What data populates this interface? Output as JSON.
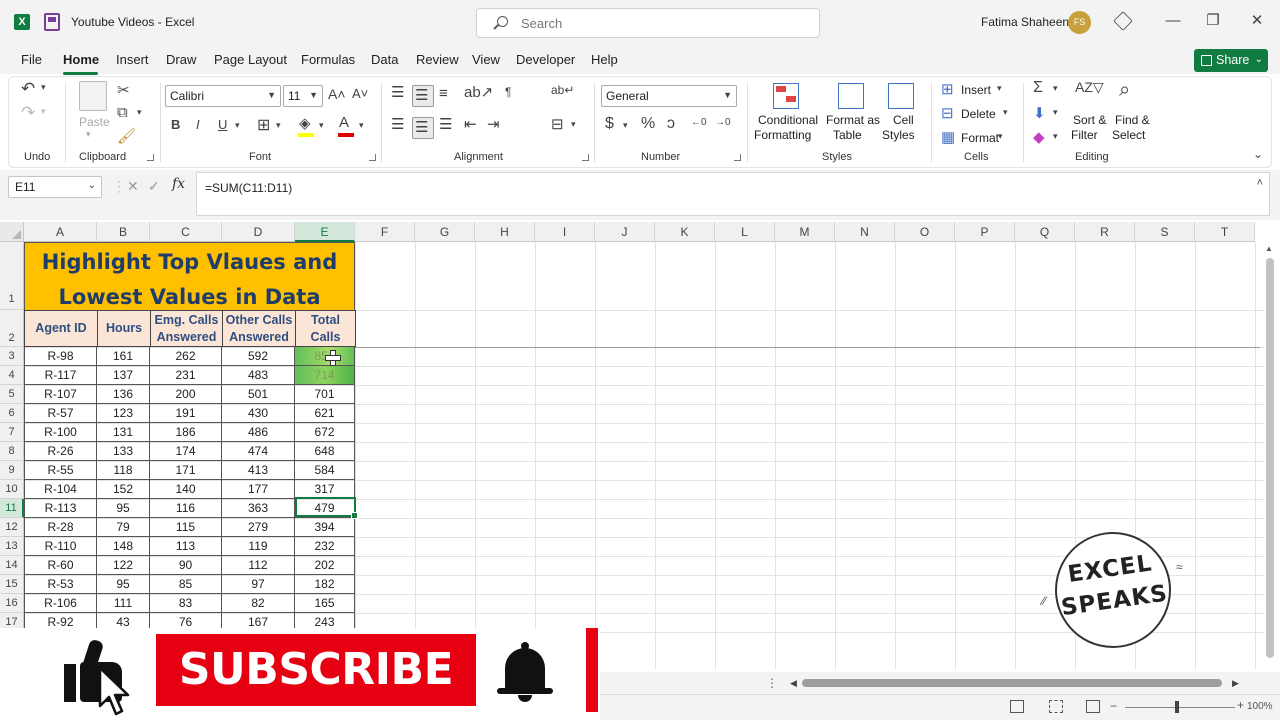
{
  "window": {
    "doc_title": "Youtube Videos  -  Excel",
    "search_placeholder": "Search",
    "user_name": "Fatima Shaheen",
    "user_initials": "FS"
  },
  "menu": {
    "items": [
      "File",
      "Home",
      "Insert",
      "Draw",
      "Page Layout",
      "Formulas",
      "Data",
      "Review",
      "View",
      "Developer",
      "Help"
    ],
    "active": "Home",
    "share_label": "Share"
  },
  "ribbon": {
    "groups": {
      "undo": "Undo",
      "clipboard": "Clipboard",
      "font": "Font",
      "alignment": "Alignment",
      "number": "Number",
      "styles": "Styles",
      "cells": "Cells",
      "editing": "Editing"
    },
    "paste_label": "Paste",
    "font_name": "Calibri",
    "font_size": "11",
    "number_format": "General",
    "conditional_formatting": [
      "Conditional",
      "Formatting"
    ],
    "format_as_table": [
      "Format as",
      "Table"
    ],
    "cell_styles": [
      "Cell",
      "Styles"
    ],
    "insert_label": "Insert",
    "delete_label": "Delete",
    "format_label": "Format",
    "sort_filter": [
      "Sort &",
      "Filter"
    ],
    "find_select": [
      "Find &",
      "Select"
    ]
  },
  "formula_bar": {
    "name_box": "E11",
    "formula": "=SUM(C11:D11)"
  },
  "columns": [
    "A",
    "B",
    "C",
    "D",
    "E",
    "F",
    "G",
    "H",
    "I",
    "J",
    "K",
    "L",
    "M",
    "N",
    "O",
    "P",
    "Q",
    "R",
    "S",
    "T"
  ],
  "rows": [
    "1",
    "2",
    "3",
    "4",
    "5",
    "6",
    "7",
    "8",
    "9",
    "10",
    "11",
    "12",
    "13",
    "14",
    "15",
    "16",
    "17"
  ],
  "sheet": {
    "title_line1": "Highlight Top Vlaues and",
    "title_line2": "Lowest Values in Data",
    "headers": [
      [
        "Agent ID"
      ],
      [
        "Hours"
      ],
      [
        "Emg. Calls",
        "Answered"
      ],
      [
        "Other Calls",
        "Answered"
      ],
      [
        "Total",
        "Calls"
      ]
    ],
    "data": [
      [
        "R-98",
        "161",
        "262",
        "592",
        "854"
      ],
      [
        "R-117",
        "137",
        "231",
        "483",
        "714"
      ],
      [
        "R-107",
        "136",
        "200",
        "501",
        "701"
      ],
      [
        "R-57",
        "123",
        "191",
        "430",
        "621"
      ],
      [
        "R-100",
        "131",
        "186",
        "486",
        "672"
      ],
      [
        "R-26",
        "133",
        "174",
        "474",
        "648"
      ],
      [
        "R-55",
        "118",
        "171",
        "413",
        "584"
      ],
      [
        "R-104",
        "152",
        "140",
        "177",
        "317"
      ],
      [
        "R-113",
        "95",
        "116",
        "363",
        "479"
      ],
      [
        "R-28",
        "79",
        "115",
        "279",
        "394"
      ],
      [
        "R-110",
        "148",
        "113",
        "119",
        "232"
      ],
      [
        "R-60",
        "122",
        "90",
        "112",
        "202"
      ],
      [
        "R-53",
        "95",
        "85",
        "97",
        "182"
      ],
      [
        "R-106",
        "111",
        "83",
        "82",
        "165"
      ],
      [
        "R-92",
        "43",
        "76",
        "167",
        "243"
      ]
    ]
  },
  "logo": {
    "line1": "EXCEL",
    "line2": "SPEAKS"
  },
  "overlay": {
    "subscribe_label": "SUBSCRIBE"
  },
  "status": {
    "zoom": "100%"
  },
  "colors": {
    "excel_green": "#107c41",
    "title_fill": "#ffc000",
    "header_fill": "#fbe5d6",
    "highlight_green": "#63be5a",
    "subscribe_red": "#e60012"
  }
}
